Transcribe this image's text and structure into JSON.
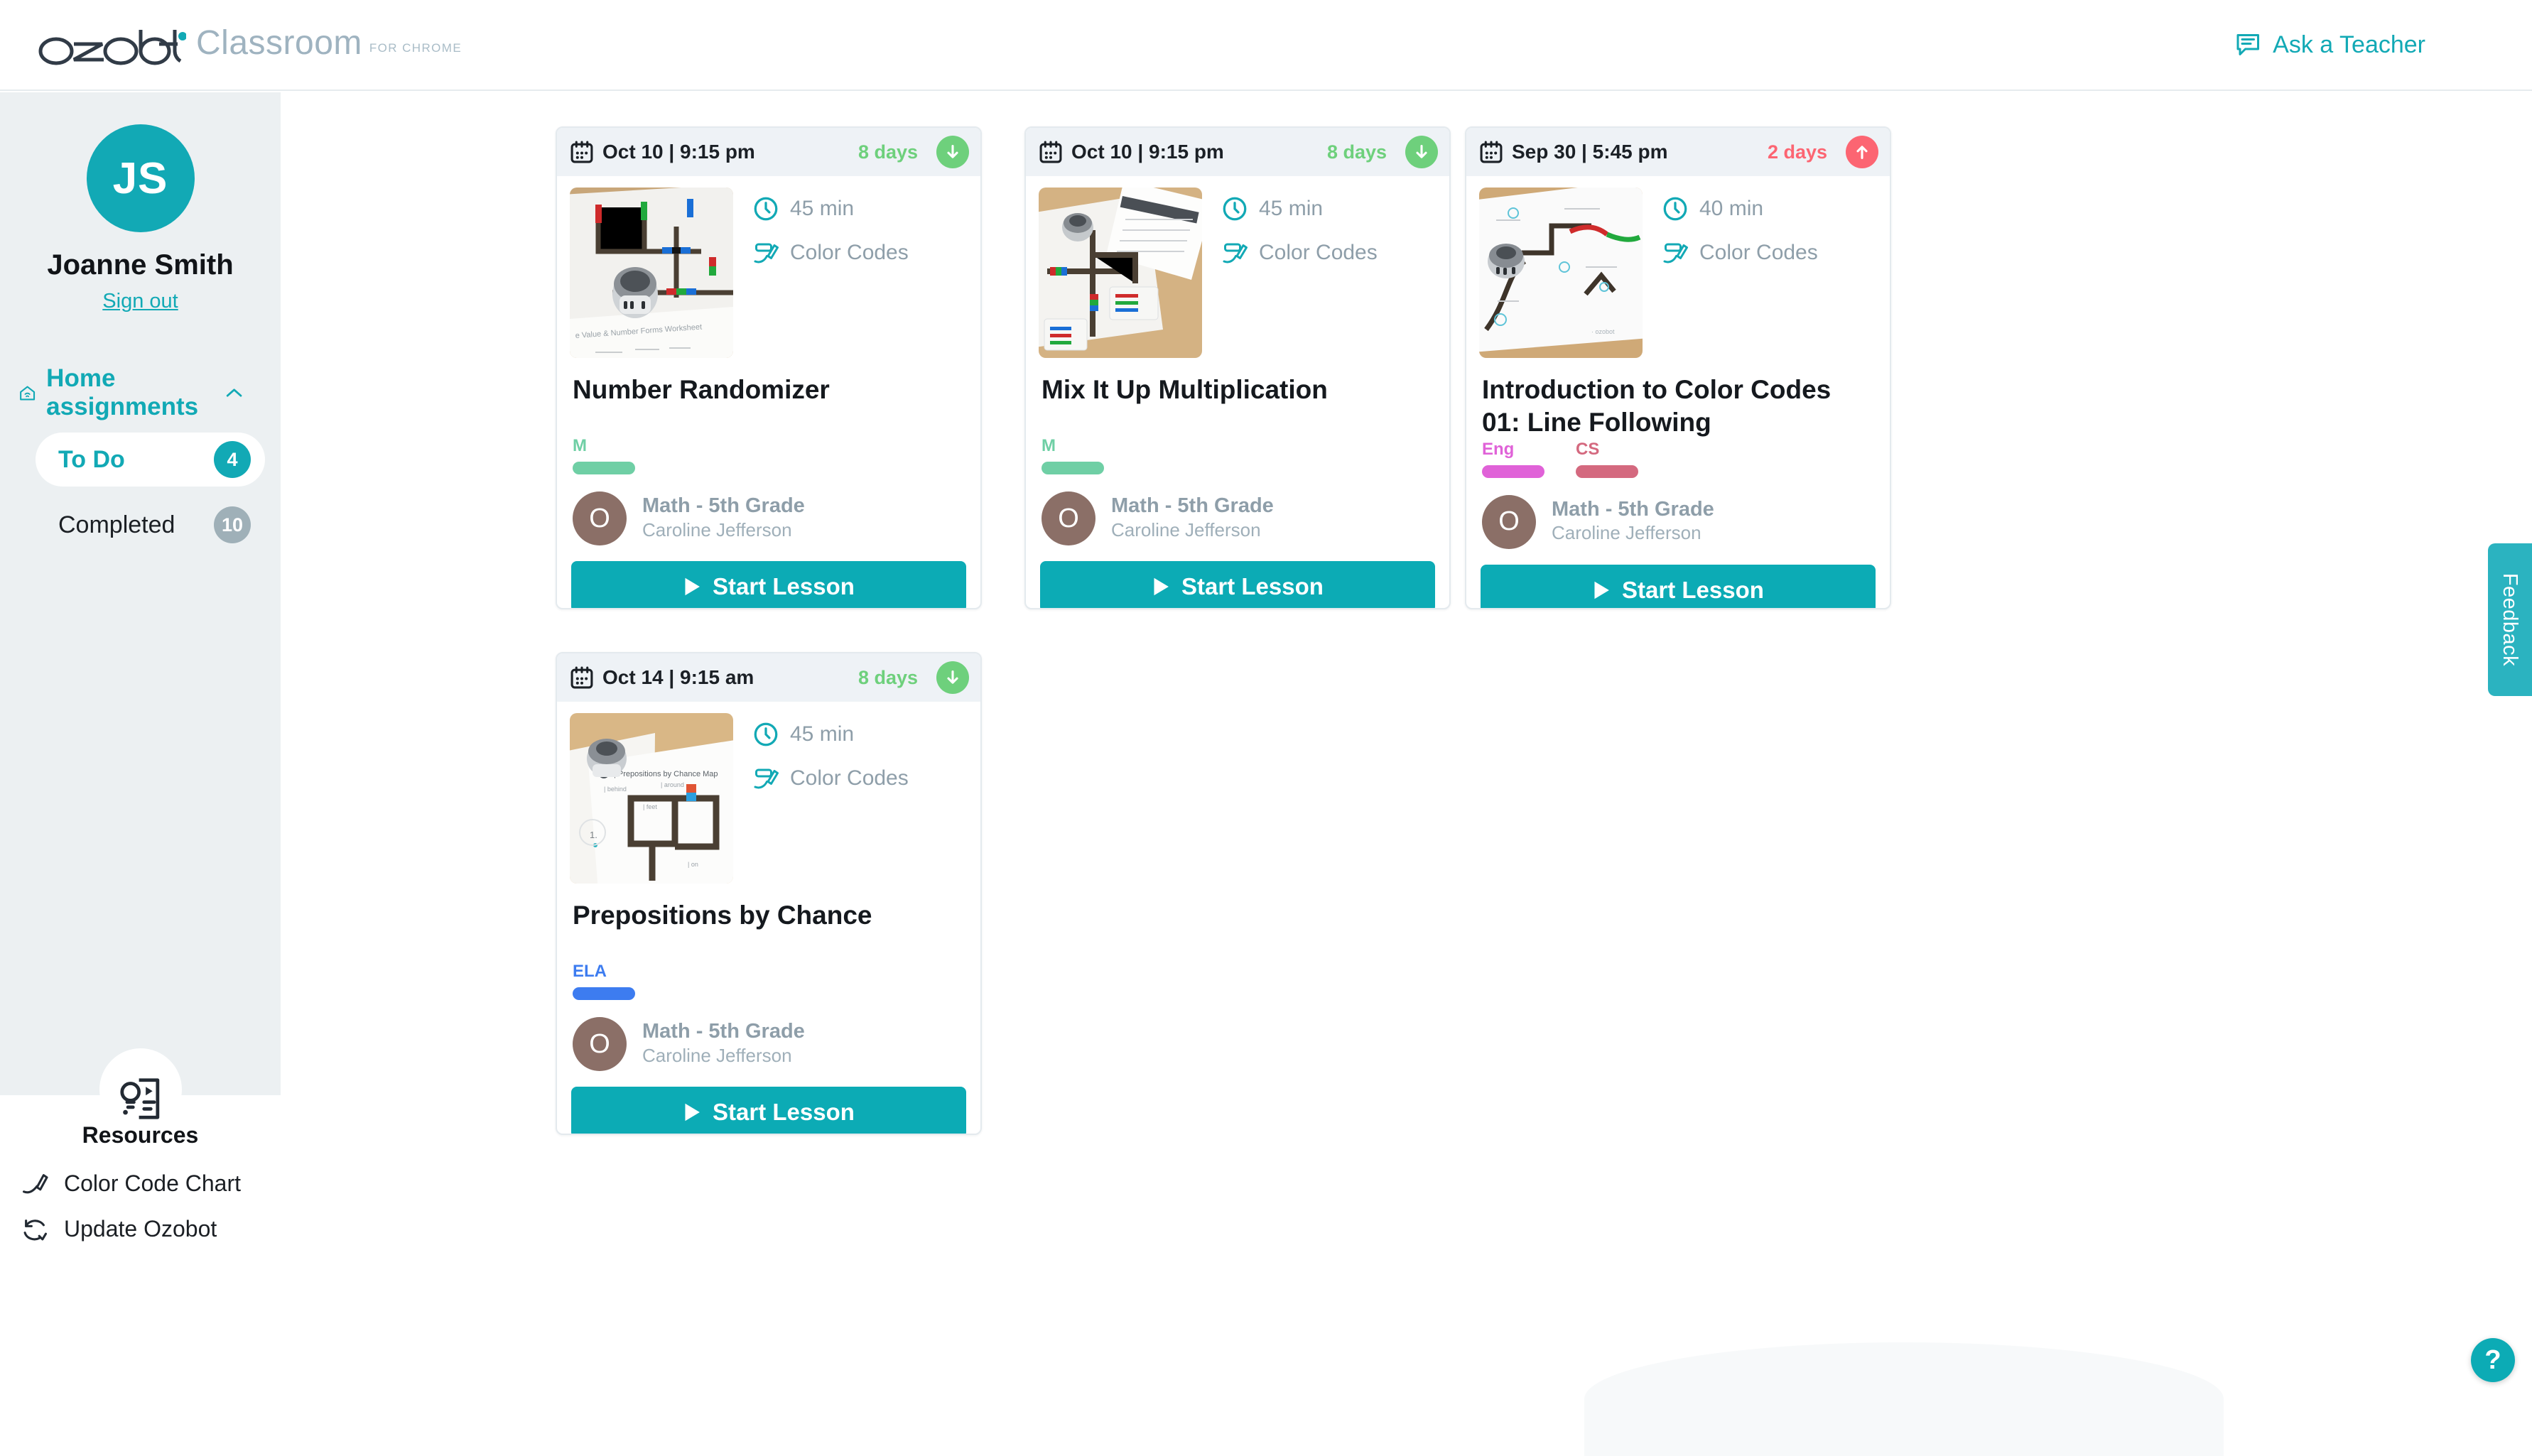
{
  "header": {
    "brand_name": "ozobot",
    "product": "Classroom",
    "product_suffix": "FOR CHROME",
    "ask_teacher_label": "Ask a Teacher",
    "ask_teacher_icon": "chat-bubble-icon",
    "accent_color": "#12a9b5"
  },
  "sidebar": {
    "avatar_initials": "JS",
    "user_name": "Joanne Smith",
    "sign_out_label": "Sign out",
    "section_label": "Home assignments",
    "section_icon": "home-wifi-icon",
    "collapse_icon": "chevron-up-icon",
    "items": [
      {
        "label": "To Do",
        "count": "4",
        "active": true,
        "badge_color": "#12a9b5"
      },
      {
        "label": "Completed",
        "count": "10",
        "active": false,
        "badge_color": "#9fb0b8"
      }
    ],
    "resources": {
      "title": "Resources",
      "icon": "lightbulb-document-icon",
      "links": [
        {
          "label": "Color Code Chart",
          "icon": "marker-pen-icon"
        },
        {
          "label": "Update Ozobot",
          "icon": "refresh-check-icon"
        }
      ]
    }
  },
  "cards": [
    {
      "date": "Oct 10 | 9:15 pm",
      "calendar_icon": "calendar-icon",
      "days": "8 days",
      "days_state": "ok",
      "days_icon": "arrow-down-icon",
      "duration": "45 min",
      "duration_icon": "clock-icon",
      "mode": "Color Codes",
      "mode_icon": "marker-pen-icon",
      "title": "Number Randomizer",
      "tags": [
        {
          "label": "M",
          "color": "#6fcfa5"
        }
      ],
      "teacher_initial": "O",
      "class": "Math - 5th Grade",
      "teacher": "Caroline Jefferson",
      "start_label": "Start Lesson",
      "start_icon": "play-icon"
    },
    {
      "date": "Oct 10 | 9:15 pm",
      "calendar_icon": "calendar-icon",
      "days": "8 days",
      "days_state": "ok",
      "days_icon": "arrow-down-icon",
      "duration": "45 min",
      "duration_icon": "clock-icon",
      "mode": "Color Codes",
      "mode_icon": "marker-pen-icon",
      "title": "Mix It Up Multiplication",
      "tags": [
        {
          "label": "M",
          "color": "#6fcfa5"
        }
      ],
      "teacher_initial": "O",
      "class": "Math - 5th Grade",
      "teacher": "Caroline Jefferson",
      "start_label": "Start Lesson",
      "start_icon": "play-icon"
    },
    {
      "date": "Sep 30 | 5:45 pm",
      "calendar_icon": "calendar-icon",
      "days": "2 days",
      "days_state": "late",
      "days_icon": "arrow-up-icon",
      "duration": "40 min",
      "duration_icon": "clock-icon",
      "mode": "Color Codes",
      "mode_icon": "marker-pen-icon",
      "title": "Introduction to Color Codes 01: Line Following",
      "tags": [
        {
          "label": "Eng",
          "color": "#e062d8"
        },
        {
          "label": "CS",
          "color": "#d4697f"
        }
      ],
      "teacher_initial": "O",
      "class": "Math - 5th Grade",
      "teacher": "Caroline Jefferson",
      "start_label": "Start Lesson",
      "start_icon": "play-icon"
    },
    {
      "date": "Oct 14 | 9:15 am",
      "calendar_icon": "calendar-icon",
      "days": "8 days",
      "days_state": "ok",
      "days_icon": "arrow-down-icon",
      "duration": "45 min",
      "duration_icon": "clock-icon",
      "mode": "Color Codes",
      "mode_icon": "marker-pen-icon",
      "title": "Prepositions by Chance",
      "tags": [
        {
          "label": "ELA",
          "color": "#3d7cf0"
        }
      ],
      "teacher_initial": "O",
      "class": "Math - 5th Grade",
      "teacher": "Caroline Jefferson",
      "start_label": "Start Lesson",
      "start_icon": "play-icon"
    }
  ],
  "widgets": {
    "feedback_label": "Feedback",
    "help_label": "?"
  },
  "colors": {
    "teal": "#12a9b5",
    "green": "#6ed07c",
    "coral": "#fc6572",
    "sidebar_bg": "#ecf0f2",
    "card_head_bg": "#eef2f6"
  }
}
